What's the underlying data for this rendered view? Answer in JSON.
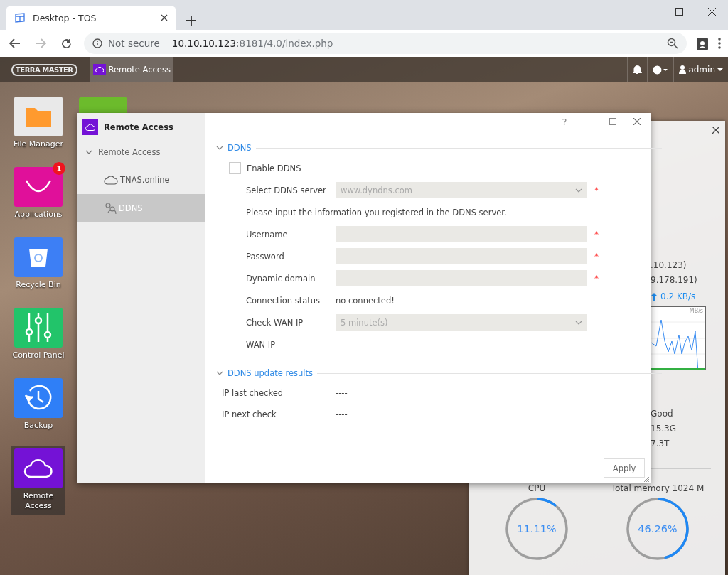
{
  "browser": {
    "tab_title": "Desktop - TOS",
    "security": "Not secure",
    "url_host": "10.10.10.123",
    "url_path": ":8181/4.0/index.php"
  },
  "topbar": {
    "logo": "TERRA MASTER",
    "tasks": [
      {
        "label": "Remote Access",
        "selected": true
      }
    ],
    "user": "admin"
  },
  "desktop_icons": [
    {
      "label": "File Manager",
      "kind": "folder",
      "selected": false
    },
    {
      "label": "Applications",
      "kind": "bag",
      "badge": "1",
      "selected": false
    },
    {
      "label": "Recycle Bin",
      "kind": "bin",
      "selected": false
    },
    {
      "label": "Control Panel",
      "kind": "sliders",
      "selected": false
    },
    {
      "label": "Backup",
      "kind": "clock",
      "selected": false
    },
    {
      "label": "Remote Access",
      "kind": "cloud",
      "selected": true
    }
  ],
  "widget": {
    "ip_lines": [
      ".10.123)",
      "9.178.191)"
    ],
    "upload": "0.2 KB/s",
    "chart_unit": "MB/s",
    "stats": [
      "Good",
      "15.3G",
      "7.3T"
    ],
    "meters": [
      {
        "label": "CPU",
        "reading": "11.11%",
        "level": 0.1111
      },
      {
        "label": "Total memory 1024 M",
        "reading": "46.26%",
        "level": 0.4626
      }
    ]
  },
  "window": {
    "title": "Remote Access",
    "sidebar": {
      "items": [
        {
          "label": "Remote Access",
          "expanded": true,
          "children": [
            {
              "label": "TNAS.online",
              "kind": "cloud",
              "selected": false
            },
            {
              "label": "DDNS",
              "kind": "ddns",
              "selected": true
            }
          ]
        }
      ]
    },
    "sections": [
      {
        "title": "DDNS",
        "expanded": true,
        "rows": [
          {
            "kind": "checkbox",
            "label": "Enable DDNS",
            "checked": false
          },
          {
            "kind": "select",
            "label": "Select DDNS server",
            "value": "www.dyndns.com",
            "required": true,
            "disabled": true
          },
          {
            "kind": "note",
            "text": "Please input the information you registered in the DDNS server."
          },
          {
            "kind": "input",
            "label": "Username",
            "required": true,
            "disabled": true
          },
          {
            "kind": "input",
            "label": "Password",
            "required": true,
            "disabled": true
          },
          {
            "kind": "input",
            "label": "Dynamic domain",
            "required": true,
            "disabled": true
          },
          {
            "kind": "text",
            "label": "Connection status",
            "value": "no connected!"
          },
          {
            "kind": "select",
            "label": "Check WAN IP",
            "value": "5 minute(s)",
            "required": false,
            "disabled": true
          },
          {
            "kind": "text",
            "label": "WAN IP",
            "value": "---"
          }
        ]
      },
      {
        "title": "DDNS update results",
        "expanded": true,
        "rows": [
          {
            "kind": "result",
            "label": "IP last checked",
            "value": "----"
          },
          {
            "kind": "result",
            "label": "IP next check",
            "value": "----"
          }
        ]
      }
    ],
    "help": "?",
    "required_mark": "*",
    "apply": "Apply"
  }
}
